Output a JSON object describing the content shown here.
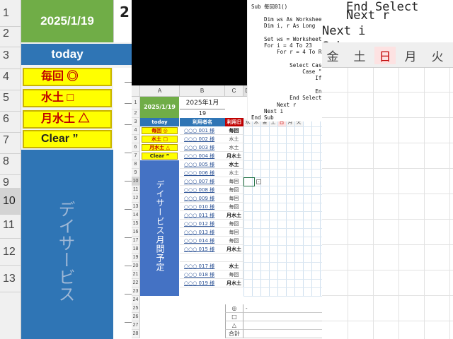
{
  "bg_left": {
    "date": "2025/1/19",
    "date_cell_right": "2",
    "today": "today",
    "rows": [
      "1",
      "2",
      "3",
      "4",
      "5",
      "6",
      "7",
      "8",
      "9",
      "10",
      "11",
      "12",
      "13"
    ],
    "buttons": [
      "毎回 ◎",
      "水土 □",
      "月水土 △",
      "Clear ”"
    ],
    "vertical_title": "デイサービス"
  },
  "bg_right": {
    "code_lines": [
      "Next r",
      "Next i",
      "Sub",
      "End Select"
    ],
    "days": [
      "金",
      "土",
      "日",
      "月",
      "火"
    ]
  },
  "sheet": {
    "columns": [
      "A",
      "B",
      "C",
      "D"
    ],
    "rows": [
      "1",
      "2",
      "3",
      "4",
      "5",
      "6",
      "7",
      "8",
      "9",
      "10",
      "11",
      "12",
      "13",
      "14",
      "15",
      "16",
      "17",
      "18",
      "19",
      "20",
      "21",
      "22",
      "23",
      "24",
      "25",
      "26",
      "27",
      "28"
    ],
    "date": "2025/1/19",
    "month": "2025年1月",
    "day": "19",
    "today_label": "today",
    "user_header": "利用者名",
    "date_header": "利用日",
    "buttons": [
      {
        "label": "毎回 ◎"
      },
      {
        "label": "水土 □"
      },
      {
        "label": "月水土 △"
      },
      {
        "label": "Clear ”"
      }
    ],
    "vertical_title": "デイサービス月間予定",
    "users": [
      {
        "name": "○○○ 001 様",
        "pattern": "毎回"
      },
      {
        "name": "○○○ 002 様",
        "pattern": "水土"
      },
      {
        "name": "○○○ 003 様",
        "pattern": "水土"
      },
      {
        "name": "○○○ 004 様",
        "pattern": "月水土"
      },
      {
        "name": "○○○ 005 様",
        "pattern": "水土"
      },
      {
        "name": "○○○ 006 様",
        "pattern": "水土"
      },
      {
        "name": "○○○ 007 様",
        "pattern": "毎回"
      },
      {
        "name": "○○○ 008 様",
        "pattern": "毎回"
      },
      {
        "name": "○○○ 009 様",
        "pattern": "毎回"
      },
      {
        "name": "○○○ 010 様",
        "pattern": "毎回"
      },
      {
        "name": "○○○ 011 様",
        "pattern": "月水土"
      },
      {
        "name": "○○○ 012 様",
        "pattern": "毎回"
      },
      {
        "name": "○○○ 013 様",
        "pattern": "毎回"
      },
      {
        "name": "○○○ 014 様",
        "pattern": "毎回"
      },
      {
        "name": "○○○ 015 様",
        "pattern": "月水土"
      },
      {
        "name": "",
        "pattern": ""
      },
      {
        "name": "○○○ 017 様",
        "pattern": "水土"
      },
      {
        "name": "○○○ 018 様",
        "pattern": "毎回"
      },
      {
        "name": "○○○ 019 様",
        "pattern": "月水土"
      }
    ],
    "summary": [
      {
        "label": "◎",
        "value": "-"
      },
      {
        "label": "□",
        "value": ""
      },
      {
        "label": "△",
        "value": ""
      },
      {
        "label": "合計",
        "value": ""
      }
    ],
    "day_headers": [
      "水",
      "木",
      "金",
      "土",
      "日",
      "月",
      "火"
    ],
    "autofill_glyph": "-"
  },
  "code": {
    "lines": [
      "Sub 毎回01()",
      "",
      "    Dim ws As Worksheet",
      "    Dim i, r As Long",
      "",
      "    Set ws = Worksheets(",
      "    For i = 4 To 23",
      "        For r = 4 To R",
      "",
      "            Select Case",
      "                Case \"",
      "                    If",
      "",
      "                    En",
      "            End Select",
      "        Next r",
      "    Next i",
      "End Sub"
    ]
  }
}
